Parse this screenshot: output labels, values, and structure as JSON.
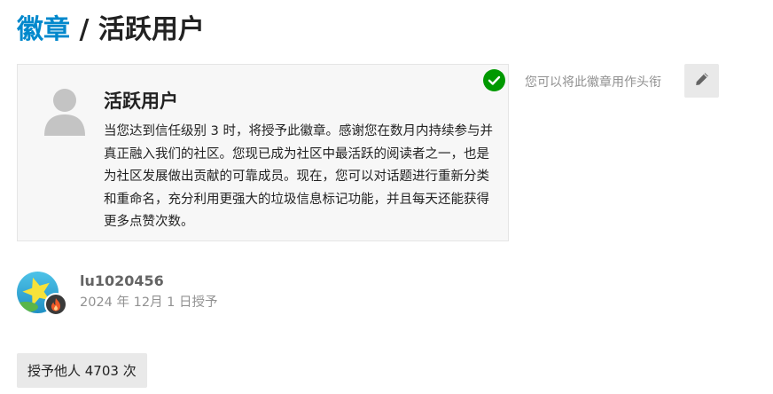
{
  "breadcrumb": {
    "parent_label": "徽章",
    "separator": " / ",
    "current_label": "活跃用户"
  },
  "badge": {
    "name": "活跃用户",
    "description": "当您达到信任级别 3 时，将授予此徽章。感谢您在数月内持续参与并真正融入我们的社区。您现已成为社区中最活跃的阅读者之一，也是为社区发展做出贡献的可靠成员。现在，您可以对话题进行重新分类和重命名，充分利用更强大的垃圾信息标记功能，并且每天还能获得更多点赞次数。",
    "icon": "user-icon",
    "granted_status_icon": "check-circle-icon"
  },
  "title_option": {
    "hint": "您可以将此徽章用作头衔",
    "edit_icon": "pencil-icon"
  },
  "grant": {
    "username": "lu1020456",
    "granted_at": "2024 年 12月 1 日授予",
    "avatar_flair_icon": "fire-icon"
  },
  "granted_count": {
    "label": "授予他人 4703 次"
  },
  "colors": {
    "link": "#0088cc",
    "success": "#009900",
    "muted": "#919191",
    "button_bg": "#e9e9e9",
    "card_bg": "#f7f7f7"
  }
}
